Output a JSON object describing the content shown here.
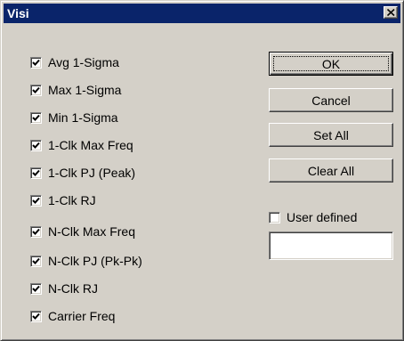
{
  "window": {
    "title": "Visi",
    "close_icon": "close-icon"
  },
  "checkboxes": [
    {
      "label": "Avg 1-Sigma",
      "checked": true
    },
    {
      "label": "Max 1-Sigma",
      "checked": true
    },
    {
      "label": "Min 1-Sigma",
      "checked": true
    },
    {
      "label": "1-Clk Max Freq",
      "checked": true
    },
    {
      "label": "1-Clk PJ (Peak)",
      "checked": true
    },
    {
      "label": "1-Clk RJ",
      "checked": true
    },
    {
      "label": "N-Clk Max Freq",
      "checked": true
    },
    {
      "label": "N-Clk PJ (Pk-Pk)",
      "checked": true
    },
    {
      "label": "N-Clk RJ",
      "checked": true
    },
    {
      "label": "Carrier Freq",
      "checked": true
    }
  ],
  "buttons": {
    "ok": "OK",
    "cancel": "Cancel",
    "set_all": "Set All",
    "clear_all": "Clear All"
  },
  "user_defined": {
    "label": "User defined",
    "checked": false,
    "value": ""
  },
  "colors": {
    "title_bar": "#0a246a",
    "face": "#d4d0c8"
  }
}
